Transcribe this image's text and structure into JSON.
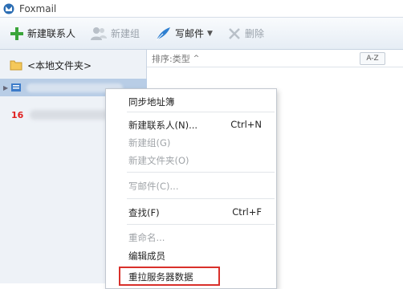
{
  "window": {
    "title": "Foxmail"
  },
  "toolbar": {
    "new_contact": "新建联系人",
    "new_group": "新建组",
    "write_mail": "写邮件",
    "delete": "删除"
  },
  "sidebar": {
    "local_folder": "<本地文件夹>",
    "account_badge": "16"
  },
  "contacts": {
    "sort_label": "排序:类型",
    "az_label": "A-Z"
  },
  "context_menu": {
    "items": [
      {
        "label": "同步地址簿",
        "shortcut": "",
        "enabled": true
      },
      {
        "label": "新建联系人(N)...",
        "shortcut": "Ctrl+N",
        "enabled": true
      },
      {
        "label": "新建组(G)",
        "shortcut": "",
        "enabled": false
      },
      {
        "label": "新建文件夹(O)",
        "shortcut": "",
        "enabled": false
      },
      {
        "label": "写邮件(C)...",
        "shortcut": "",
        "enabled": false
      },
      {
        "label": "查找(F)",
        "shortcut": "Ctrl+F",
        "enabled": true
      },
      {
        "label": "重命名...",
        "shortcut": "",
        "enabled": false
      },
      {
        "label": "编辑成员",
        "shortcut": "",
        "enabled": true
      },
      {
        "label": "重拉服务器数据",
        "shortcut": "",
        "enabled": true
      }
    ]
  },
  "colors": {
    "highlight_border": "#d9302b",
    "selection": "#b8cde6"
  }
}
